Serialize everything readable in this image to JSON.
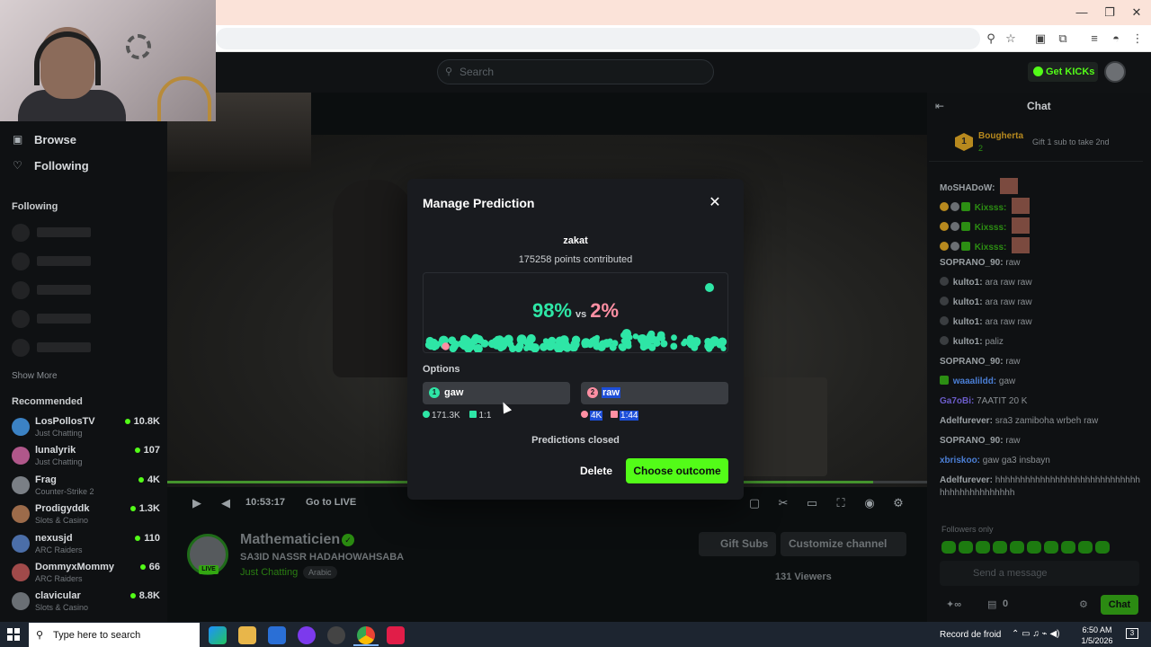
{
  "browser": {
    "window_controls": [
      "—",
      "❐",
      "✕"
    ]
  },
  "topbar": {
    "search_placeholder": "Search",
    "get_kicks": "Get KICKs"
  },
  "sidebar": {
    "nav": [
      {
        "label": "Browse",
        "icon": "browse-icon"
      },
      {
        "label": "Following",
        "icon": "heart-icon"
      }
    ],
    "following_heading": "Following",
    "show_more": "Show More",
    "recommended_heading": "Recommended",
    "recommended": [
      {
        "name": "LosPollosTV",
        "category": "Just Chatting",
        "viewers": "10.8K",
        "color": "#3b82c4"
      },
      {
        "name": "lunalyrik",
        "category": "Just Chatting",
        "viewers": "107",
        "color": "#b0578a"
      },
      {
        "name": "Frag",
        "category": "Counter-Strike 2",
        "viewers": "4K",
        "color": "#7a7f85"
      },
      {
        "name": "Prodigyddk",
        "category": "Slots & Casino",
        "viewers": "1.3K",
        "color": "#9c6b4a"
      },
      {
        "name": "nexusjd",
        "category": "ARC Raiders",
        "viewers": "110",
        "color": "#4b6ea8"
      },
      {
        "name": "DommyxMommy",
        "category": "ARC Raiders",
        "viewers": "66",
        "color": "#a04a4a"
      },
      {
        "name": "clavicular",
        "category": "Slots & Casino",
        "viewers": "8.8K",
        "color": "#6a6f74"
      }
    ]
  },
  "player": {
    "timecode": "10:53:17",
    "go_live": "Go to LIVE"
  },
  "stream": {
    "channel": "Mathematicien",
    "title": "SA3ID NASSR HADAHOWAHSABA",
    "category": "Just Chatting",
    "tag": "Arabic",
    "live": "LIVE",
    "gift_subs": "Gift Subs",
    "customize": "Customize channel",
    "viewers": "131 Viewers"
  },
  "chat": {
    "title": "Chat",
    "pinned": {
      "rank": "1",
      "name": "Bougherta",
      "count": "2",
      "gift_text": "Gift 1 sub to take 2nd"
    },
    "messages": [
      {
        "user": "MoSHADoW:",
        "text": "",
        "color": "#9aa0a4"
      },
      {
        "user": "Kixsss:",
        "text": "",
        "color": "#2c8e13"
      },
      {
        "user": "Kixsss:",
        "text": "",
        "color": "#2c8e13"
      },
      {
        "user": "Kixsss:",
        "text": "",
        "color": "#2c8e13"
      },
      {
        "user": "SOPRANO_90:",
        "text": "raw",
        "color": "#9aa0a4"
      },
      {
        "user": "kulto1:",
        "text": "ara raw raw",
        "color": "#9aa0a4"
      },
      {
        "user": "kulto1:",
        "text": "ara raw raw",
        "color": "#9aa0a4"
      },
      {
        "user": "kulto1:",
        "text": "ara raw raw",
        "color": "#9aa0a4"
      },
      {
        "user": "kulto1:",
        "text": "paliz",
        "color": "#9aa0a4"
      },
      {
        "user": "SOPRANO_90:",
        "text": "raw",
        "color": "#9aa0a4"
      },
      {
        "user": "waaalildd:",
        "text": "gaw",
        "color": "#4b7fd6"
      },
      {
        "user": "Ga7oBi:",
        "text": "7AATIT 20 K",
        "color": "#6b5cc9"
      },
      {
        "user": "Adelfurever:",
        "text": "sra3 zamiboha wrbeh raw",
        "color": "#9aa0a4"
      },
      {
        "user": "SOPRANO_90:",
        "text": "raw",
        "color": "#9aa0a4"
      },
      {
        "user": "xbriskoo:",
        "text": "gaw ga3 insbayn",
        "color": "#4b7fd6"
      },
      {
        "user": "Adelfurever:",
        "text": "hhhhhhhhhhhhhhhhhhhhhhhhhhhhhhhhhhhhhhhhhhhh",
        "color": "#9aa0a4"
      }
    ],
    "followers_only": "Followers only",
    "send_placeholder": "Send a message",
    "points": "0",
    "chat_button": "Chat"
  },
  "prediction": {
    "heading": "Manage Prediction",
    "question": "zakat",
    "points_contributed": "175258 points contributed",
    "pct_a": "98%",
    "vs": "vs",
    "pct_b": "2%",
    "color_a": "#2ee6a6",
    "color_b": "#ff8fa3",
    "options_label": "Options",
    "options": [
      {
        "num": "1",
        "label": "gaw",
        "points": "171.3K",
        "ratio": "1:1"
      },
      {
        "num": "2",
        "label": "raw",
        "points": "4K",
        "ratio": "1:44"
      }
    ],
    "status": "Predictions closed",
    "delete": "Delete",
    "choose_outcome": "Choose outcome"
  },
  "taskbar": {
    "search": "Type here to search",
    "weather": "Record de froid",
    "time": "6:50 AM",
    "date": "1/5/2026",
    "notifications": "3"
  }
}
